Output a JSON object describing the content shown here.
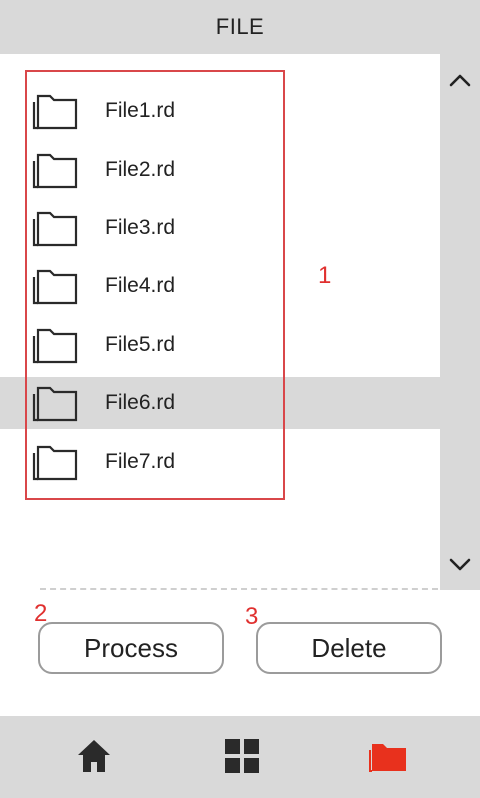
{
  "header": {
    "title": "FILE"
  },
  "files": [
    {
      "name": "File1.rd",
      "selected": false
    },
    {
      "name": "File2.rd",
      "selected": false
    },
    {
      "name": "File3.rd",
      "selected": false
    },
    {
      "name": "File4.rd",
      "selected": false
    },
    {
      "name": "File5.rd",
      "selected": false
    },
    {
      "name": "File6.rd",
      "selected": true
    },
    {
      "name": "File7.rd",
      "selected": false
    }
  ],
  "annotations": {
    "list": "1",
    "process": "2",
    "delete": "3"
  },
  "actions": {
    "process_label": "Process",
    "delete_label": "Delete"
  },
  "nav": {
    "items": [
      {
        "icon": "home-icon",
        "active": false
      },
      {
        "icon": "grid-icon",
        "active": false
      },
      {
        "icon": "folder-icon",
        "active": true
      }
    ]
  },
  "colors": {
    "accent": "#e8311d",
    "annotation": "#e0302f",
    "selected_row": "#d9d9d9",
    "nav_icon": "#2a2a2a"
  }
}
